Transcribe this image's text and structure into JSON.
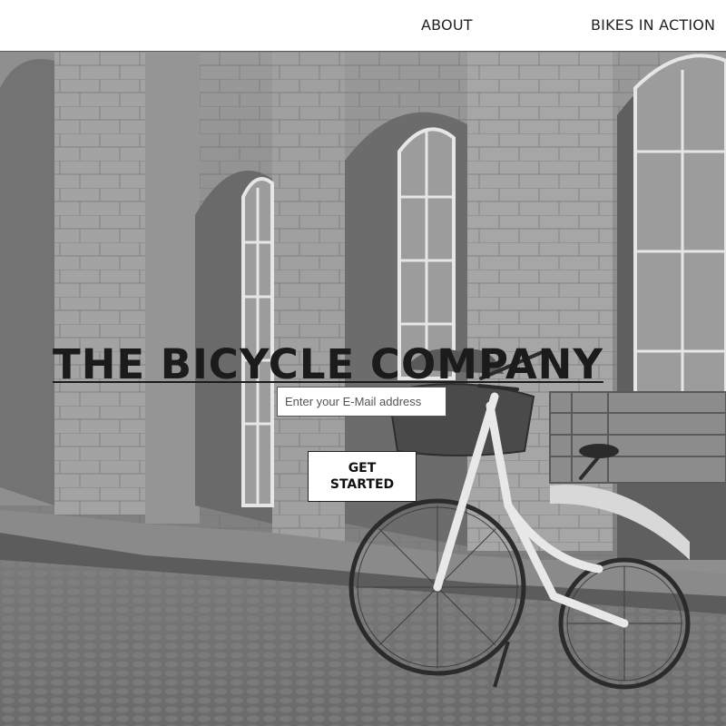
{
  "nav": {
    "items": [
      {
        "label": "ABOUT"
      },
      {
        "label": "BIKES IN ACTION"
      }
    ]
  },
  "hero": {
    "title": "THE BICYCLE COMPANY",
    "email_placeholder": "Enter your E-Mail address",
    "cta_label": "GET STARTED",
    "background_image": "grayscale-street-with-bicycle"
  },
  "colors": {
    "nav_bg": "#ffffff",
    "title": "#1b1b1b",
    "hero_tone": "#8e8e8e"
  }
}
